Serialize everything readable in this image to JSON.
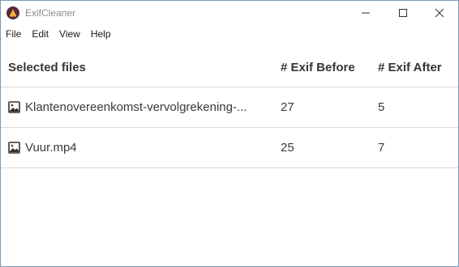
{
  "window": {
    "title": "ExifCleaner"
  },
  "menu": {
    "items": [
      {
        "label": "File"
      },
      {
        "label": "Edit"
      },
      {
        "label": "View"
      },
      {
        "label": "Help"
      }
    ]
  },
  "table": {
    "headers": {
      "files": "Selected files",
      "before": "# Exif Before",
      "after": "# Exif After"
    },
    "rows": [
      {
        "name": "Klantenovereenkomst-vervolgrekening-...",
        "before": "27",
        "after": "5",
        "icon": "image-file-icon"
      },
      {
        "name": "Vuur.mp4",
        "before": "25",
        "after": "7",
        "icon": "image-file-icon"
      }
    ]
  }
}
